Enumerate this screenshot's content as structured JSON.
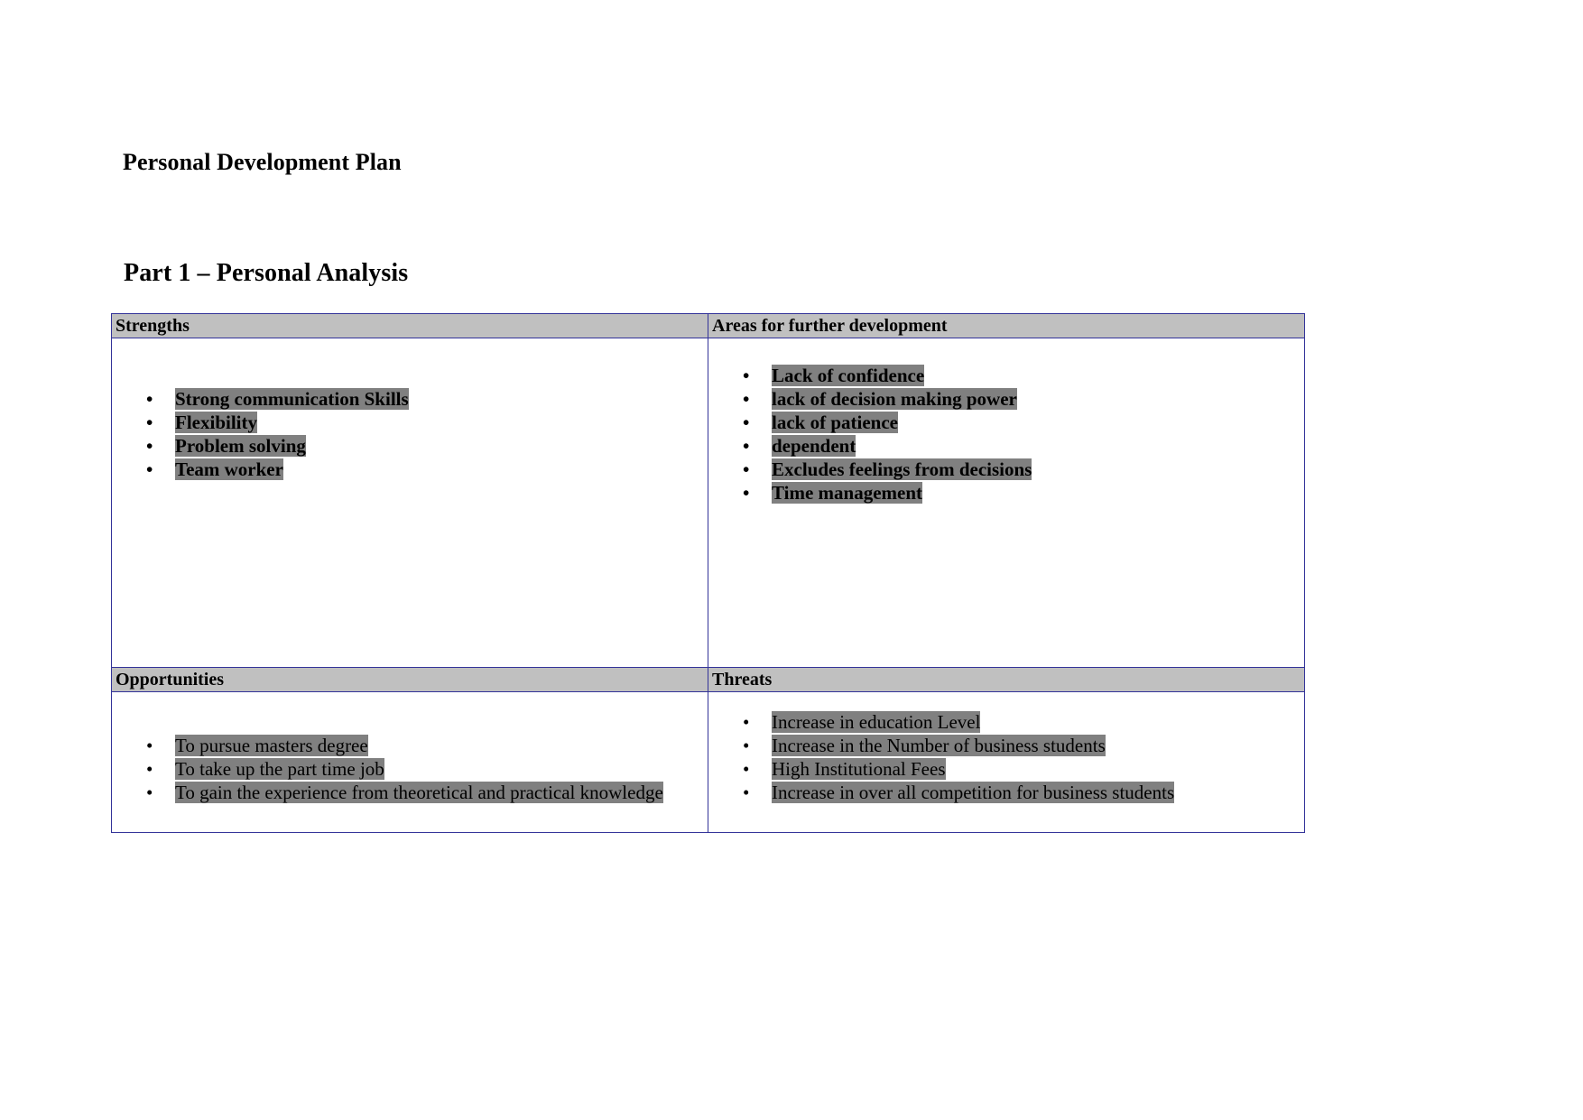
{
  "document": {
    "title": "Personal Development Plan",
    "section_heading": "Part 1 – Personal Analysis"
  },
  "colors": {
    "header_fill": "#c0c0c0",
    "highlight": "#808080",
    "table_border": "#333399",
    "text": "#000000",
    "page_background": "#ffffff"
  },
  "swot": {
    "quadrants": {
      "strengths": {
        "header": "Strengths",
        "bold": true,
        "items": [
          "Strong communication Skills",
          "Flexibility",
          "Problem solving",
          "Team worker"
        ]
      },
      "areas_for_further_development": {
        "header": "Areas for further development",
        "bold": true,
        "items": [
          "Lack of confidence",
          "lack of decision making power",
          "lack of patience",
          "dependent",
          "Excludes feelings from decisions",
          "Time management"
        ]
      },
      "opportunities": {
        "header": "Opportunities",
        "bold": false,
        "items": [
          "To pursue masters degree",
          "To take up the part time job",
          "To gain the experience from theoretical and practical knowledge"
        ]
      },
      "threats": {
        "header": "Threats",
        "bold": false,
        "items": [
          "Increase in education Level",
          "Increase in the Number of  business students",
          "High Institutional Fees",
          "Increase in over all competition for business students"
        ]
      }
    }
  }
}
